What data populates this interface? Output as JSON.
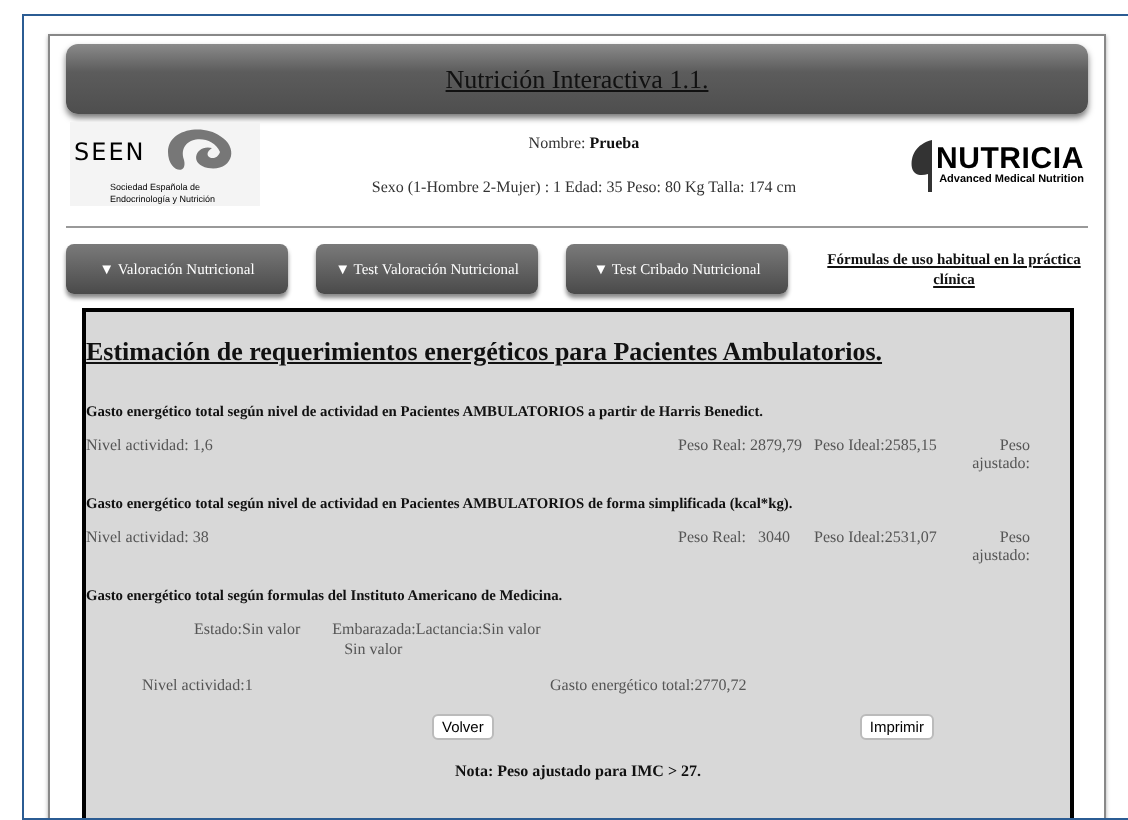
{
  "header": {
    "title": "Nutrición Interactiva 1.1."
  },
  "logo_left": {
    "name": "SEEN",
    "subtitle": "Sociedad Española de Endocrinología y Nutrición"
  },
  "patient": {
    "name_line": "Nombre: **Prueba**",
    "details": "Sexo (1-Hombre 2-Mujer) : 1 Edad: 35 Peso: 80 Kg Talla: 174 cm"
  },
  "logo_right": {
    "name": "NUTRICIA",
    "subtitle": "Advanced Medical Nutrition"
  },
  "nav": {
    "buttons": [
      {
        "arrow": "▼",
        "label": "Valoración Nutricional"
      },
      {
        "arrow": "▼",
        "label": "Test Valoración Nutricional"
      },
      {
        "arrow": "▼",
        "label": "Test Cribado Nutricional"
      }
    ],
    "link": "Fórmulas de uso habitual en la práctica clínica"
  },
  "content": {
    "heading": "Estimación de requerimientos energéticos para Pacientes Ambulatorios.",
    "sections": [
      {
        "kind": "weights",
        "title": "Gasto energético total según nivel de actividad en Pacientes AMBULATORIOS a partir de Harris Benedict.",
        "activity": "Nivel actividad: 1,6",
        "real": "Peso Real: 2879,79",
        "ideal": "Peso Ideal:2585,15",
        "adjusted": "Peso ajustado:"
      },
      {
        "kind": "weights",
        "title": "Gasto energético total según nivel de actividad en Pacientes AMBULATORIOS de forma simplificada (kcal*kg).",
        "activity": "Nivel actividad: 38",
        "real": "Peso Real:   3040",
        "ideal": "Peso Ideal:2531,07",
        "adjusted": "Peso ajustado:"
      },
      {
        "kind": "iom",
        "title": "Gasto energético total según formulas del Instituto Americano de Medicina.",
        "estado": "Estado:Sin valor",
        "embarazada": "Embarazada:Lactancia:Sin valor",
        "embarazada_value": "Sin valor",
        "activity": "Nivel actividad:1",
        "total": "Gasto energético total:2770,72"
      }
    ],
    "buttons": [
      "Volver",
      "Imprimir"
    ],
    "note": "Nota: Peso ajustado para IMC > 27."
  }
}
